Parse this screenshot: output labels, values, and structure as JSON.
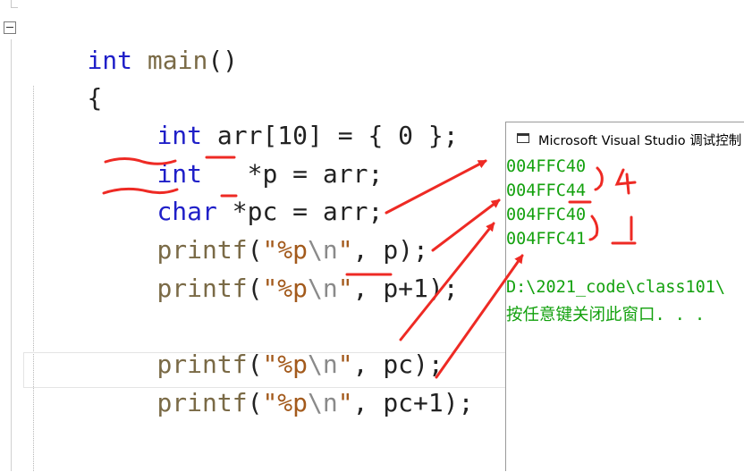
{
  "editor": {
    "lines": [
      {
        "parts": [
          "int",
          " ",
          "main",
          "()"
        ]
      },
      {
        "parts": [
          "{"
        ]
      },
      {
        "parts": [
          "int",
          " arr[10] = { 0 };"
        ]
      },
      {
        "parts": [
          "int",
          "   *p = arr;"
        ]
      },
      {
        "parts": [
          "char",
          " *pc = arr;"
        ]
      },
      {
        "parts": [
          "printf",
          "(",
          "\"%p",
          "\\n",
          "\"",
          ", p);"
        ]
      },
      {
        "parts": [
          "printf",
          "(",
          "\"%p",
          "\\n",
          "\"",
          ", p+1);"
        ]
      },
      {
        "parts": [
          "printf",
          "(",
          "\"%p",
          "\\n",
          "\"",
          ", pc);"
        ]
      },
      {
        "parts": [
          "printf",
          "(",
          "\"%p",
          "\\n",
          "\"",
          ", pc+1);"
        ]
      }
    ]
  },
  "console": {
    "title": "Microsoft Visual Studio 调试控制",
    "output": [
      "004FFC40",
      "004FFC44",
      "004FFC40",
      "004FFC41",
      "",
      "D:\\2021_code\\class101\\",
      "按任意键关闭此窗口. . ."
    ]
  },
  "annotations": {
    "diff1": "4",
    "diff2": "1",
    "color": "#ee2a24"
  },
  "colors": {
    "keyword": "#1f1fc8",
    "function": "#7a6a46",
    "string": "#a35a1c",
    "console_text": "#13a10e"
  }
}
